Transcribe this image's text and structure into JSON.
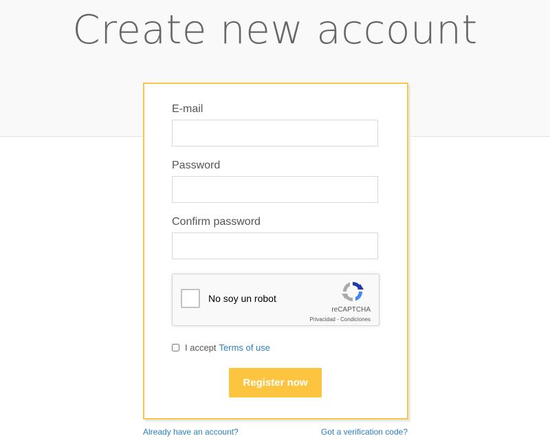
{
  "header": {
    "title": "Create new account"
  },
  "form": {
    "email_label": "E-mail",
    "email_value": "",
    "password_label": "Password",
    "password_value": "",
    "confirm_label": "Confirm password",
    "confirm_value": "",
    "recaptcha": {
      "label": "No soy un robot",
      "brand": "reCAPTCHA",
      "links": "Privacidad - Condiciones",
      "icon": "recaptcha-icon",
      "checked": false
    },
    "terms": {
      "prefix": "I accept",
      "link": "Terms of use",
      "checked": false
    },
    "submit_label": "Register now"
  },
  "footer": {
    "login_link": "Already have an account?",
    "verification_link": "Got a verification code?"
  },
  "colors": {
    "accent": "#fdc43f",
    "card_border": "#f2c94c",
    "link": "#2a7fc1"
  }
}
